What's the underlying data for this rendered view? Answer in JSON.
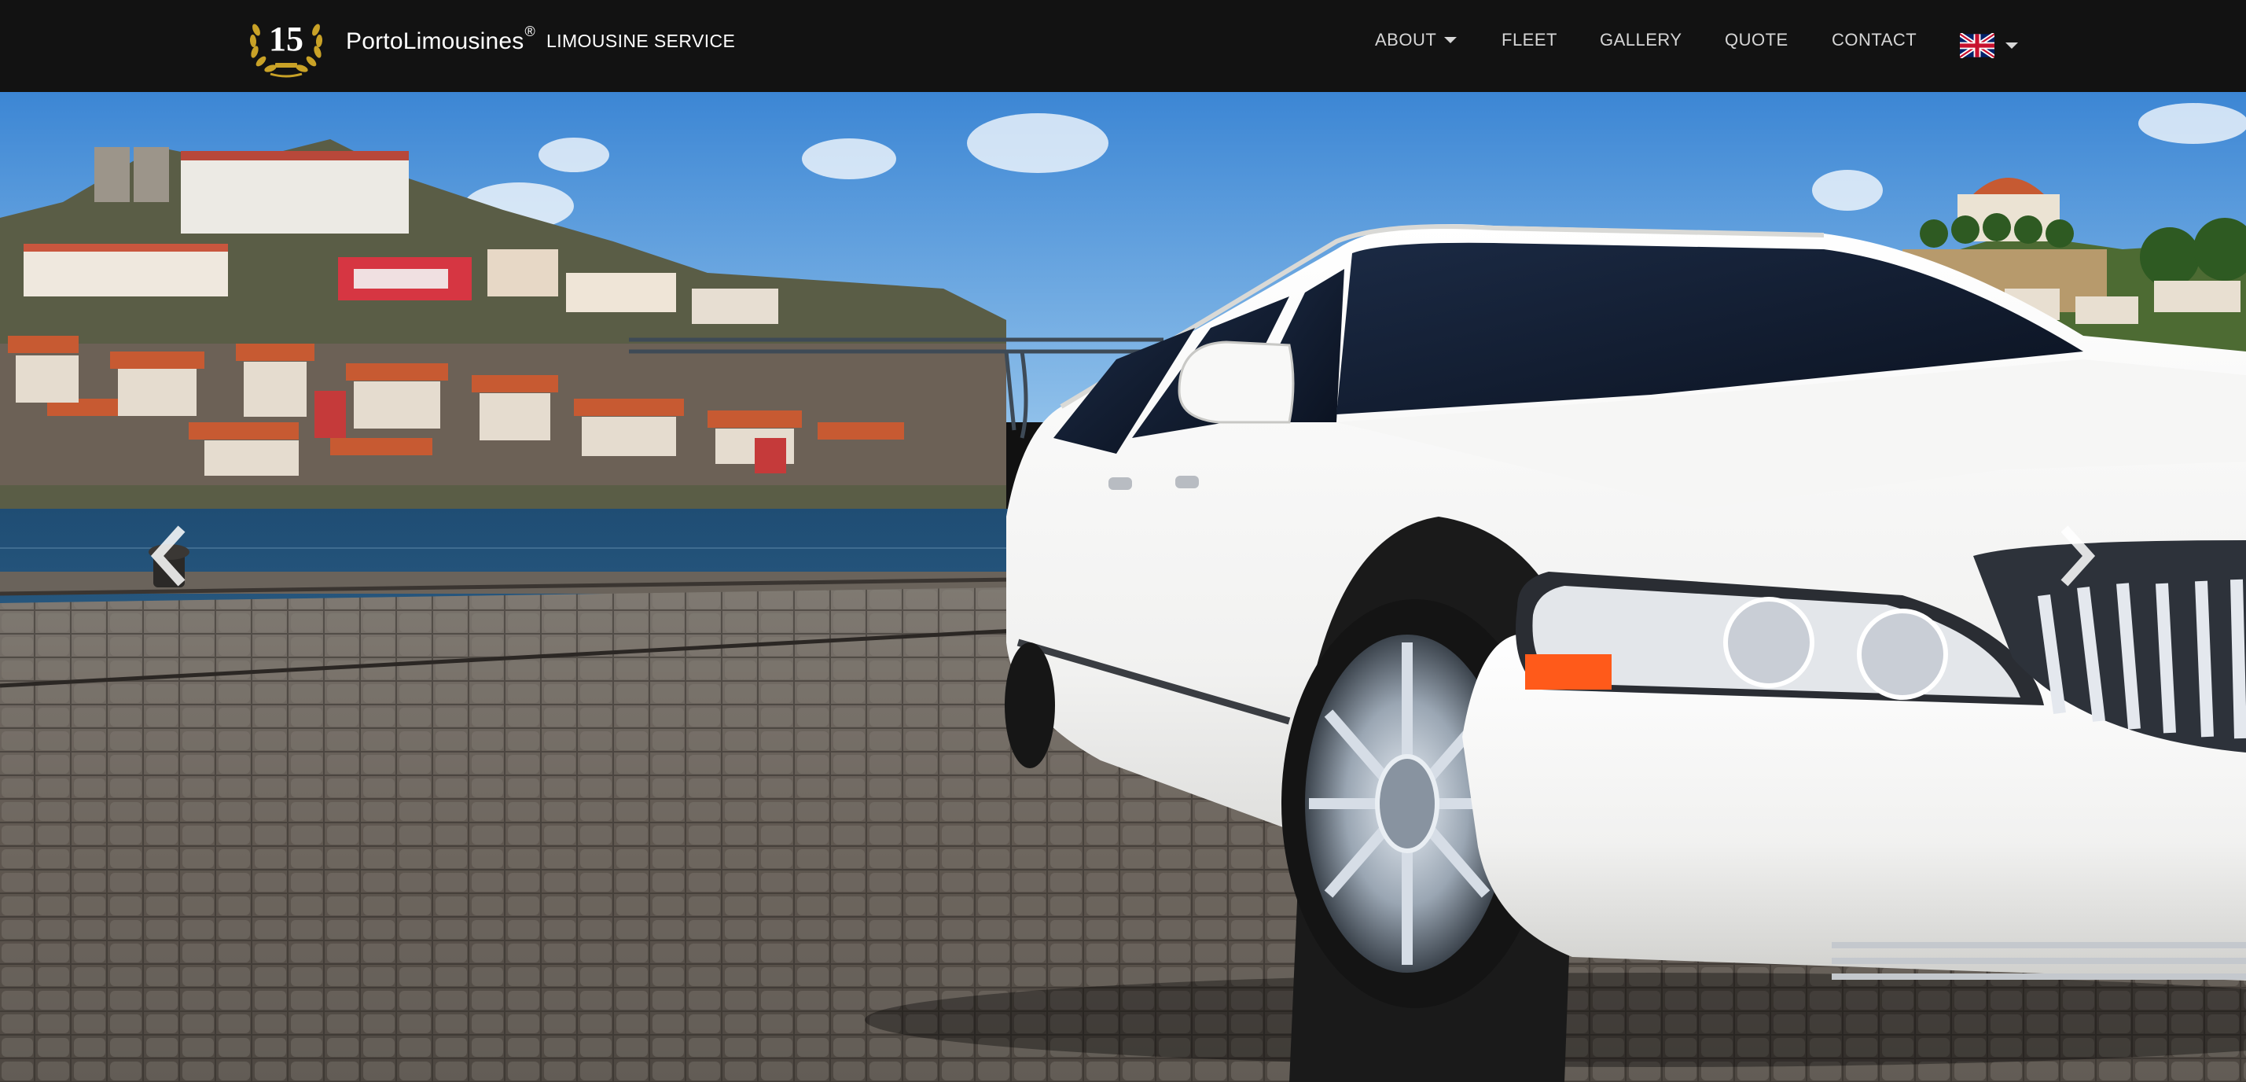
{
  "header": {
    "logo_number": "15",
    "brand_name": "PortoLimousines",
    "registered_mark": "®",
    "tagline": "LIMOUSINE SERVICE"
  },
  "nav": {
    "items": [
      {
        "label": "ABOUT",
        "has_dropdown": true
      },
      {
        "label": "FLEET"
      },
      {
        "label": "GALLERY"
      },
      {
        "label": "QUOTE"
      },
      {
        "label": "CONTACT"
      }
    ],
    "language": {
      "icon": "uk-flag-icon",
      "has_dropdown": true
    }
  },
  "hero": {
    "slide_image": "white-stretch-limousine-porto-riverside",
    "prev_icon": "chevron-left-icon",
    "next_icon": "chevron-right-icon"
  },
  "colors": {
    "navbar_bg": "#121212",
    "nav_text": "#d6d6d6",
    "brand_text": "#ffffff",
    "logo_gold": "#c9a227"
  }
}
